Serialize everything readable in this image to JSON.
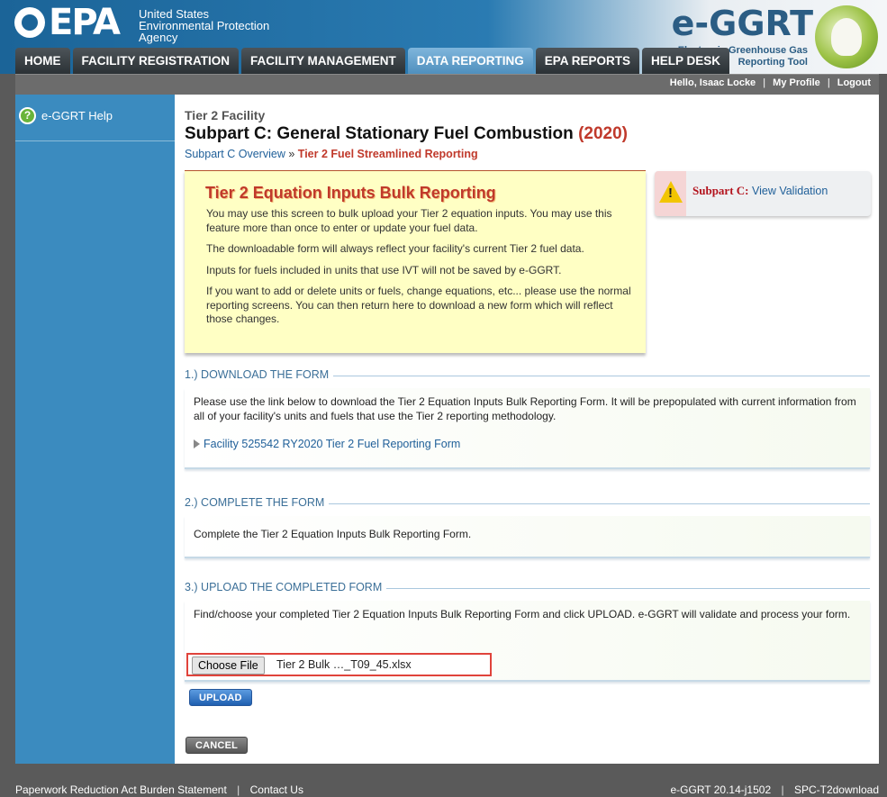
{
  "header": {
    "epa_wordmark": "EPA",
    "agency_line1": "United States",
    "agency_line2": "Environmental Protection",
    "agency_line3": "Agency",
    "brand_name": "e-GGRT",
    "brand_tagline_line1": "Electronic Greenhouse Gas",
    "brand_tagline_line2": "Reporting Tool"
  },
  "nav": {
    "tabs": [
      {
        "label": "HOME",
        "active": false
      },
      {
        "label": "FACILITY REGISTRATION",
        "active": false
      },
      {
        "label": "FACILITY MANAGEMENT",
        "active": false
      },
      {
        "label": "DATA REPORTING",
        "active": true
      },
      {
        "label": "EPA REPORTS",
        "active": false
      },
      {
        "label": "HELP DESK",
        "active": false
      }
    ]
  },
  "userbar": {
    "greeting": "Hello, Isaac Locke",
    "my_profile": "My Profile",
    "logout": "Logout",
    "separator": "|"
  },
  "sidebar": {
    "help_label": "e-GGRT Help",
    "help_icon_glyph": "?"
  },
  "page": {
    "facility_label": "Tier 2 Facility",
    "title": "Subpart C: General Stationary Fuel Combustion",
    "title_year": "(2020)",
    "breadcrumb": {
      "link": "Subpart C Overview",
      "separator": "»",
      "current": "Tier 2 Fuel Streamlined Reporting"
    }
  },
  "info_box": {
    "title": "Tier 2 Equation Inputs Bulk Reporting",
    "paragraphs": [
      "You may use this screen to bulk upload your Tier 2 equation inputs. You may use this feature more than once to enter or update your fuel data.",
      "The downloadable form will always reflect your facility's current Tier 2 fuel data.",
      "Inputs for fuels included in units that use IVT will not be saved by e-GGRT.",
      "If you want to add or delete units or fuels, change equations, etc... please use the normal reporting screens. You can then return here to download a new form which will reflect those changes."
    ]
  },
  "validation": {
    "label": "Subpart C:",
    "link": "View Validation",
    "icon_glyph": "!",
    "icon": "warning-icon"
  },
  "steps": {
    "download": {
      "title": "1.) DOWNLOAD THE FORM",
      "text": "Please use the link below to download the Tier 2 Equation Inputs Bulk Reporting Form. It will be prepopulated with current information from all of your facility's units and fuels that use the Tier 2 reporting methodology.",
      "link": "Facility 525542 RY2020 Tier 2 Fuel Reporting Form"
    },
    "complete": {
      "title": "2.) COMPLETE THE FORM",
      "text": "Complete the Tier 2 Equation Inputs Bulk Reporting Form."
    },
    "upload": {
      "title": "3.) UPLOAD THE COMPLETED FORM",
      "text": "Find/choose your completed Tier 2 Equation Inputs Bulk Reporting Form and click UPLOAD. e-GGRT will validate and process your form.",
      "choose_file_label": "Choose File",
      "file_name": "Tier 2 Bulk …_T09_45.xlsx"
    }
  },
  "buttons": {
    "upload": "UPLOAD",
    "cancel": "CANCEL"
  },
  "footer": {
    "paperwork": "Paperwork Reduction Act Burden Statement",
    "contact": "Contact Us",
    "version": "e-GGRT 20.14-j1502",
    "screen_id": "SPC-T2download",
    "separator": "|"
  },
  "colors": {
    "header_blue": "#1b6498",
    "sidebar_blue": "#3b8bbf",
    "active_tab": "#4f8fbd",
    "info_yellow": "#ffffc4",
    "accent_red": "#c0392b",
    "link_blue": "#1f5f99",
    "highlight_border": "#e0433b"
  }
}
